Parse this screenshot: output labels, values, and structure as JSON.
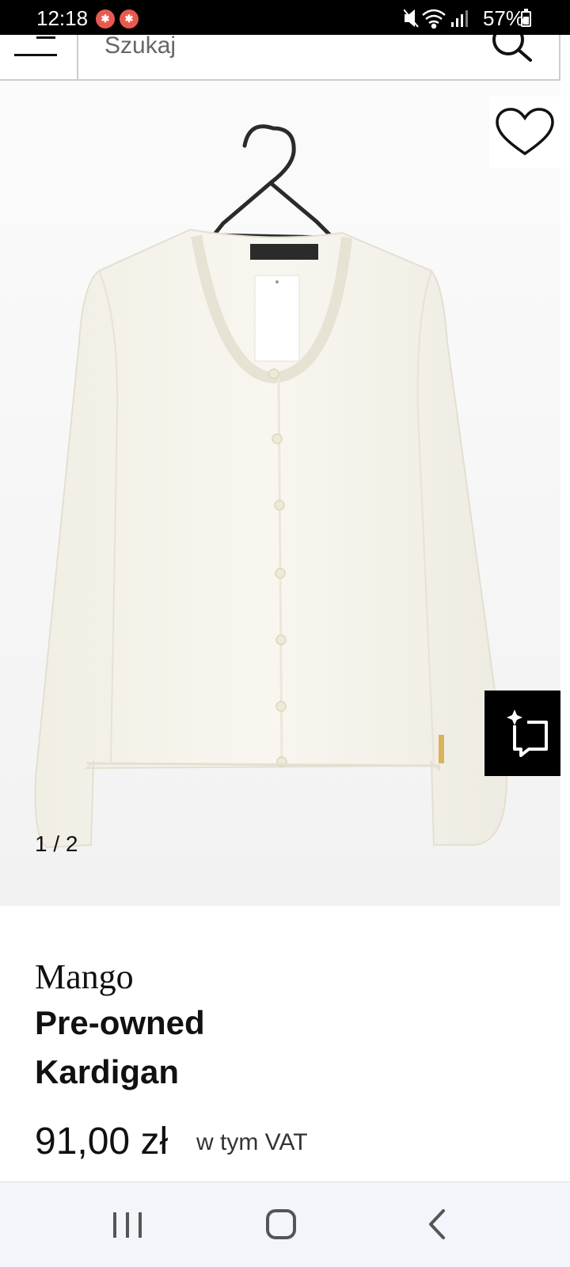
{
  "status_bar": {
    "time": "12:18",
    "notification_badges": [
      "notification-icon",
      "notification-icon"
    ],
    "battery": "57%",
    "icons": [
      "mute-icon",
      "wifi-icon",
      "signal-icon",
      "battery-icon"
    ]
  },
  "header": {
    "menu_icon": "hamburger-menu-icon",
    "search_placeholder": "Szukaj",
    "search_icon": "search-icon"
  },
  "gallery": {
    "image": "white-cardigan-on-hanger",
    "counter": "1 / 2",
    "wishlist_icon": "heart-icon",
    "ar_icon": "try-on-icon"
  },
  "product": {
    "brand": "Mango",
    "title_line1": "Pre-owned",
    "title_line2": "Kardigan",
    "price": "91,00 zł",
    "vat_note": "w tym VAT"
  },
  "navbar": {
    "buttons": [
      "recent-apps-icon",
      "home-icon",
      "back-icon"
    ]
  },
  "colors": {
    "background": "#ffffff",
    "text": "#111111",
    "status_bar": "#000000",
    "navbar": "#f2f5f9"
  }
}
